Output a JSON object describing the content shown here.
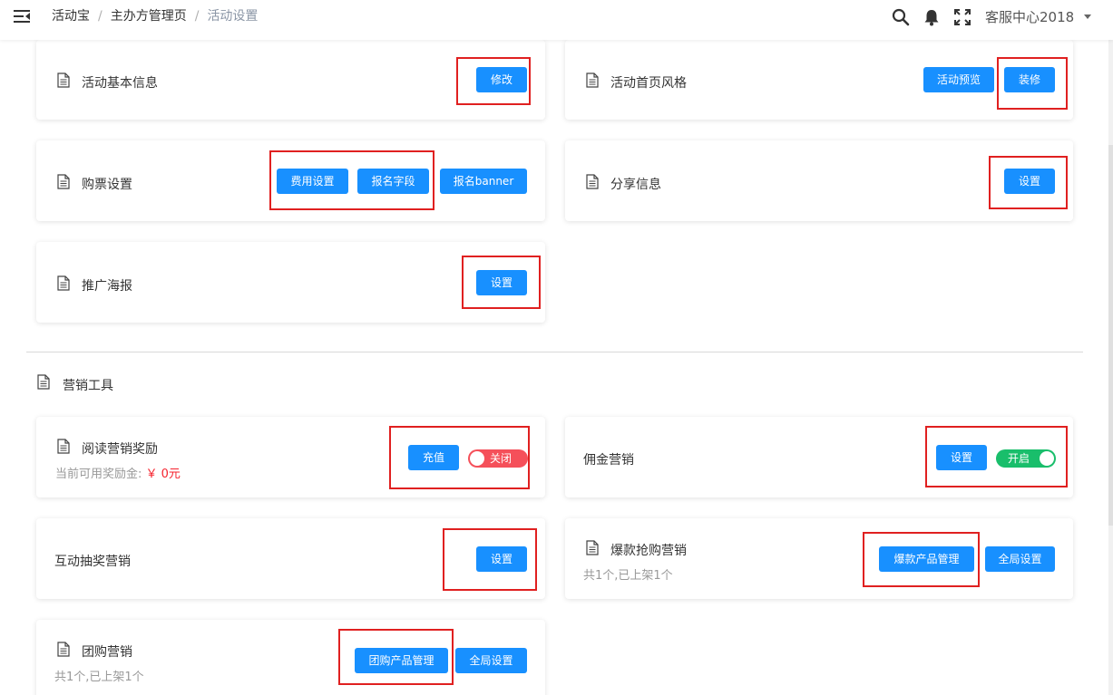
{
  "breadcrumb": {
    "items": [
      "活动宝",
      "主办方管理页",
      "活动设置"
    ],
    "separator": "/"
  },
  "header": {
    "user": "客服中心2018",
    "icons": [
      "menu-fold-icon",
      "search-icon",
      "bell-icon",
      "fullscreen-icon",
      "caret-down-icon"
    ]
  },
  "cards": {
    "basic_info": {
      "title": "活动基本信息",
      "btn_edit": "修改"
    },
    "home_style": {
      "title": "活动首页风格",
      "btn_preview": "活动预览",
      "btn_decorate": "装修"
    },
    "ticket": {
      "title": "购票设置",
      "btn_fee": "费用设置",
      "btn_field": "报名字段",
      "btn_banner": "报名banner"
    },
    "share": {
      "title": "分享信息",
      "btn_set": "设置"
    },
    "poster": {
      "title": "推广海报",
      "btn_set": "设置"
    }
  },
  "marketing": {
    "section_title": "营销工具",
    "reading": {
      "title": "阅读营销奖励",
      "sub_label": "当前可用奖励金:",
      "sub_amount": "￥ 0元",
      "btn_recharge": "充值",
      "toggle": "关闭"
    },
    "commission": {
      "title": "佣金营销",
      "btn_set": "设置",
      "toggle": "开启"
    },
    "lottery": {
      "title": "互动抽奖营销",
      "btn_set": "设置"
    },
    "flash": {
      "title": "爆款抢购营销",
      "sub": "共1个,已上架1个",
      "btn_manage": "爆款产品管理",
      "btn_global": "全局设置"
    },
    "group": {
      "title": "团购营销",
      "sub": "共1个,已上架1个",
      "btn_manage": "团购产品管理",
      "btn_global": "全局设置"
    }
  },
  "colors": {
    "primary": "#1890ff",
    "toggle_off": "#f5505a",
    "toggle_on": "#19be6b",
    "highlight": "#e02020",
    "amount": "#f5222d"
  }
}
